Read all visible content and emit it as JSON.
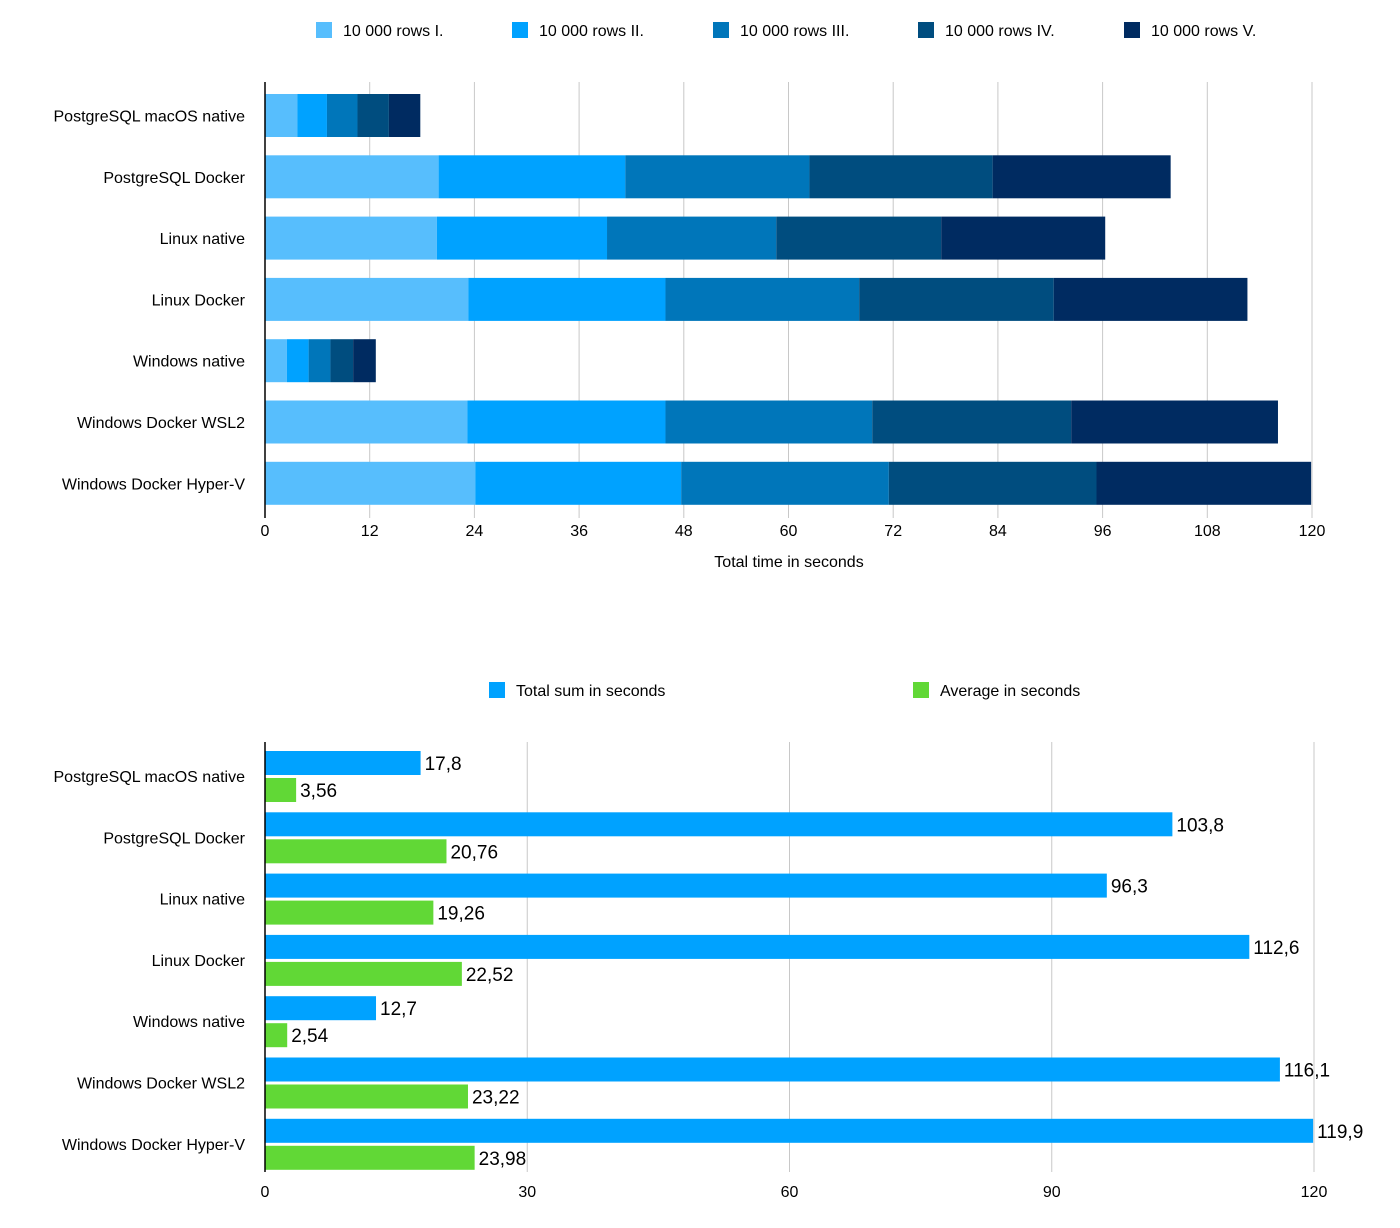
{
  "chart_data": [
    {
      "type": "bar",
      "orientation": "horizontal",
      "stacked": true,
      "categories": [
        "PostgreSQL macOS native",
        "PostgreSQL Docker",
        "Linux native",
        "Linux Docker",
        "Windows native",
        "Windows Docker WSL2",
        "Windows Docker Hyper-V"
      ],
      "series": [
        {
          "name": "10 000 rows I.",
          "color": "#57BEFD",
          "values": [
            3.7,
            19.9,
            19.7,
            23.3,
            2.5,
            23.2,
            24.1
          ]
        },
        {
          "name": "10 000 rows II.",
          "color": "#00A2FF",
          "values": [
            3.4,
            21.4,
            19.5,
            22.6,
            2.5,
            22.7,
            23.6
          ]
        },
        {
          "name": "10 000 rows III.",
          "color": "#0076BA",
          "values": [
            3.5,
            21.1,
            19.4,
            22.2,
            2.5,
            23.7,
            23.8
          ]
        },
        {
          "name": "10 000 rows IV.",
          "color": "#004D7F",
          "values": [
            3.6,
            21.0,
            18.9,
            22.3,
            2.6,
            22.8,
            23.8
          ]
        },
        {
          "name": "10 000 rows V.",
          "color": "#002B61",
          "values": [
            3.6,
            20.4,
            18.8,
            22.2,
            2.6,
            23.7,
            24.6
          ]
        }
      ],
      "title": "",
      "xlabel": "Total time in seconds",
      "ylabel": "",
      "xlim": [
        0,
        120
      ],
      "xticks": [
        "0",
        "12",
        "24",
        "36",
        "48",
        "60",
        "72",
        "84",
        "96",
        "108",
        "120"
      ],
      "grid": true,
      "legend": "top"
    },
    {
      "type": "bar",
      "orientation": "horizontal",
      "stacked": false,
      "categories": [
        "PostgreSQL macOS native",
        "PostgreSQL Docker",
        "Linux native",
        "Linux Docker",
        "Windows native",
        "Windows Docker WSL2",
        "Windows Docker Hyper-V"
      ],
      "series": [
        {
          "name": "Total sum in seconds",
          "color": "#00A2FF",
          "values": [
            17.8,
            103.8,
            96.3,
            112.6,
            12.7,
            116.1,
            119.9
          ],
          "labels": [
            "17,8",
            "103,8",
            "96,3",
            "112,6",
            "12,7",
            "116,1",
            "119,9"
          ]
        },
        {
          "name": "Average in seconds",
          "color": "#61D836",
          "values": [
            3.56,
            20.76,
            19.26,
            22.52,
            2.54,
            23.22,
            23.98
          ],
          "labels": [
            "3,56",
            "20,76",
            "19,26",
            "22,52",
            "2,54",
            "23,22",
            "23,98"
          ]
        }
      ],
      "title": "",
      "xlabel": "",
      "ylabel": "",
      "xlim": [
        0,
        120
      ],
      "xticks": [
        "0",
        "30",
        "60",
        "90",
        "120"
      ],
      "grid": true,
      "legend": "top",
      "data_labels": true
    }
  ]
}
